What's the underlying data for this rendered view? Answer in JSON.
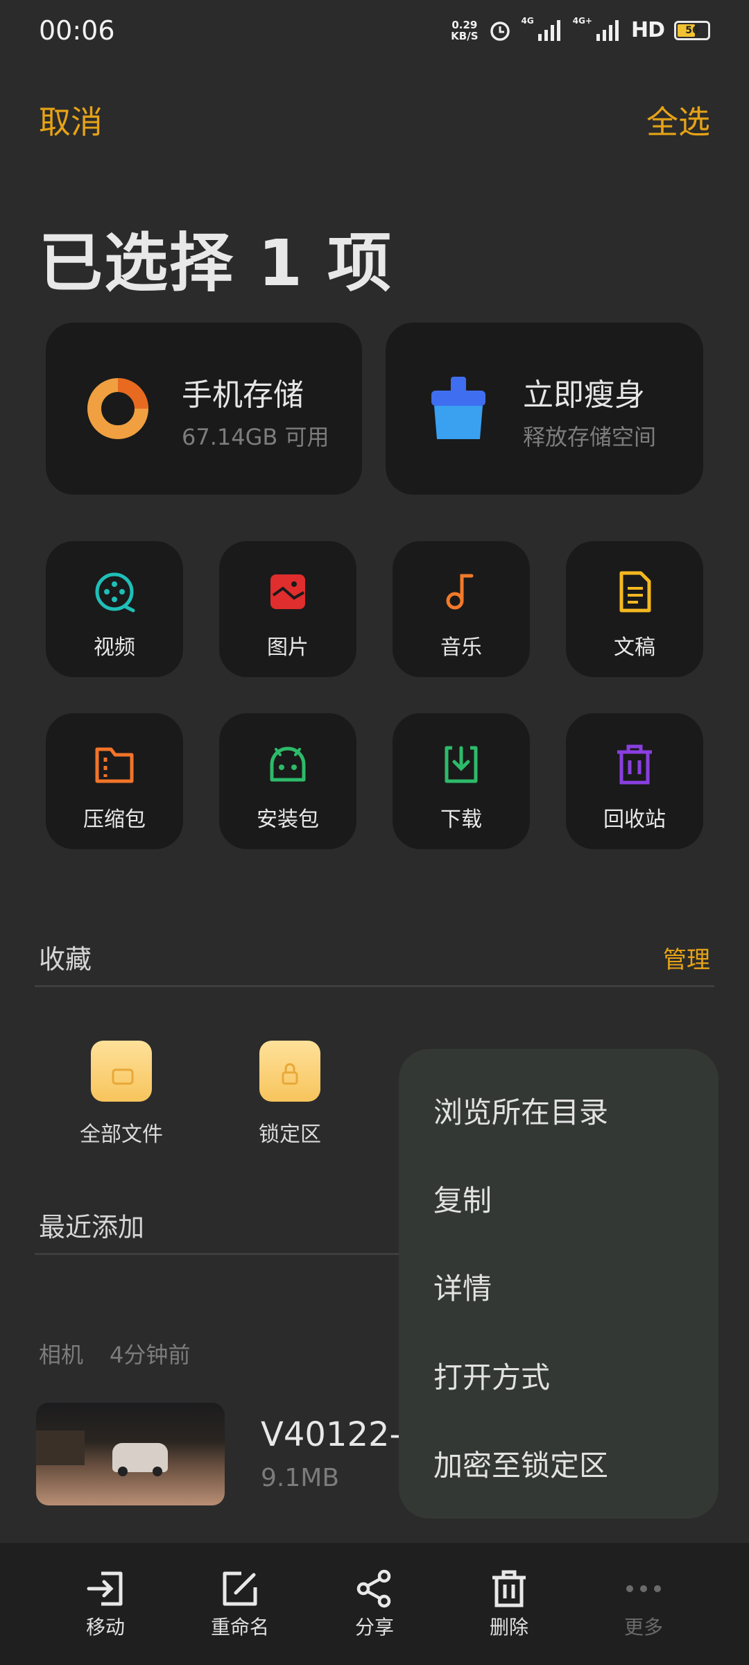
{
  "status_bar": {
    "time": "00:06",
    "net_speed_value": "0.29",
    "net_speed_unit": "KB/S",
    "signal1_label": "4G",
    "signal2_label": "4G+",
    "hd_label": "HD",
    "battery": "56"
  },
  "header": {
    "cancel_label": "取消",
    "select_all_label": "全选",
    "title": "已选择 1 项"
  },
  "storage_cards": {
    "phone": {
      "title": "手机存储",
      "subtitle": "67.14GB 可用"
    },
    "clean": {
      "title": "立即瘦身",
      "subtitle": "释放存储空间"
    }
  },
  "categories": [
    {
      "label": "视频",
      "icon": "video-icon",
      "color": "#1fbfb8"
    },
    {
      "label": "图片",
      "icon": "image-icon",
      "color": "#e02d2d"
    },
    {
      "label": "音乐",
      "icon": "music-icon",
      "color": "#f27a2a"
    },
    {
      "label": "文稿",
      "icon": "document-icon",
      "color": "#f5b820"
    },
    {
      "label": "压缩包",
      "icon": "archive-icon",
      "color": "#f2742a"
    },
    {
      "label": "安装包",
      "icon": "android-icon",
      "color": "#2dbb6a"
    },
    {
      "label": "下载",
      "icon": "download-icon",
      "color": "#2dbb6a"
    },
    {
      "label": "回收站",
      "icon": "trash-icon",
      "color": "#8a3fe0"
    }
  ],
  "favorites": {
    "title": "收藏",
    "manage_label": "管理",
    "items": [
      {
        "label": "全部文件",
        "icon": "folder-files-icon"
      },
      {
        "label": "锁定区",
        "icon": "folder-lock-icon"
      }
    ]
  },
  "recent": {
    "title": "最近添加",
    "group_source": "相机",
    "group_time": "4分钟前",
    "file_name": "V40122-",
    "file_size": "9.1MB"
  },
  "context_menu": {
    "items": [
      "浏览所在目录",
      "复制",
      "详情",
      "打开方式",
      "加密至锁定区"
    ]
  },
  "bottom_bar": {
    "move": "移动",
    "rename": "重命名",
    "share": "分享",
    "delete": "删除",
    "more": "更多"
  },
  "colors": {
    "accent": "#e6a317",
    "background": "#2b2b2b",
    "card": "#1a1a1a",
    "menu": "#343835"
  }
}
